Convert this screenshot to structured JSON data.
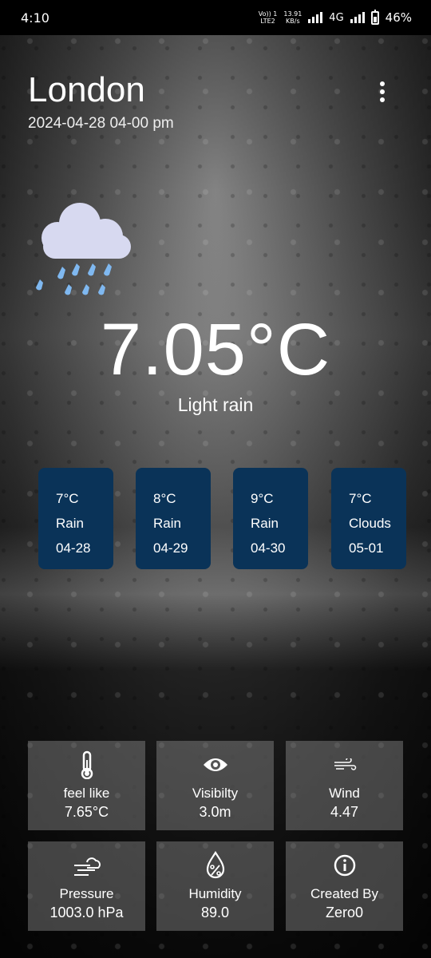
{
  "status_bar": {
    "time": "4:10",
    "network_line1": "Vo)) 1",
    "network_line2": "LTE2",
    "speed_value": "13.91",
    "speed_unit": "KB/s",
    "network_type": "4G",
    "battery": "46%"
  },
  "header": {
    "city": "London",
    "datetime": "2024-04-28 04-00 pm"
  },
  "current": {
    "icon": "rain-cloud-icon",
    "temperature": "7.05°C",
    "description": "Light rain"
  },
  "forecast": [
    {
      "temp": "7°C",
      "condition": "Rain",
      "date": "04-28"
    },
    {
      "temp": "8°C",
      "condition": "Rain",
      "date": "04-29"
    },
    {
      "temp": "9°C",
      "condition": "Rain",
      "date": "04-30"
    },
    {
      "temp": "7°C",
      "condition": "Clouds",
      "date": "05-01"
    }
  ],
  "details": [
    {
      "icon": "thermometer-icon",
      "label": "feel like",
      "value": "7.65°C"
    },
    {
      "icon": "eye-icon",
      "label": "Visibilty",
      "value": "3.0m"
    },
    {
      "icon": "wind-icon",
      "label": "Wind",
      "value": "4.47"
    },
    {
      "icon": "pressure-icon",
      "label": "Pressure",
      "value": "1003.0 hPa"
    },
    {
      "icon": "humidity-icon",
      "label": "Humidity",
      "value": "89.0"
    },
    {
      "icon": "info-icon",
      "label": "Created By",
      "value": "Zero0"
    }
  ],
  "colors": {
    "card_bg": "#0a3358",
    "cloud": "#d7d9f0",
    "rain_drop": "#7fb8f0"
  }
}
